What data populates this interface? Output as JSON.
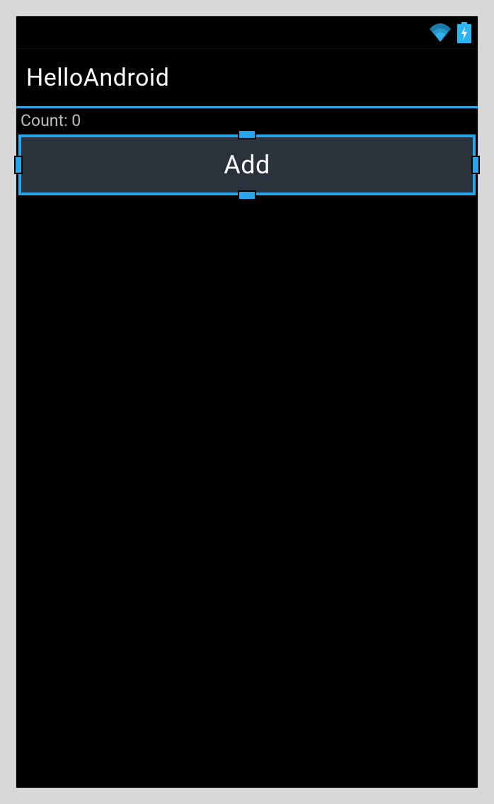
{
  "app": {
    "title": "HelloAndroid"
  },
  "status": {
    "wifi_icon": "wifi",
    "battery_icon": "battery-charging"
  },
  "main": {
    "count_label": "Count: 0",
    "add_button_label": "Add"
  },
  "colors": {
    "accent": "#29a6eb",
    "button_bg": "#2a333b"
  },
  "selection": {
    "selected_element": "add-button"
  }
}
